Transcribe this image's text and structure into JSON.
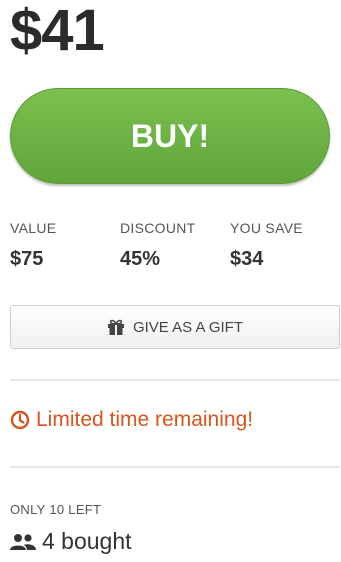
{
  "price": "$41",
  "buy_label": "BUY!",
  "stats": [
    {
      "label": "VALUE",
      "value": "$75"
    },
    {
      "label": "DISCOUNT",
      "value": "45%"
    },
    {
      "label": "YOU SAVE",
      "value": "$34"
    }
  ],
  "gift_label": "GIVE AS A GIFT",
  "limited_text": "Limited time remaining!",
  "only_left_text": "ONLY 10 LEFT",
  "bought_text": "4 bought",
  "icons": {
    "gift": "gift-icon",
    "clock": "clock-icon",
    "people": "people-icon"
  },
  "colors": {
    "buy_green": "#6ab344",
    "alert_orange": "#d9541e",
    "text_dark": "#333333"
  }
}
